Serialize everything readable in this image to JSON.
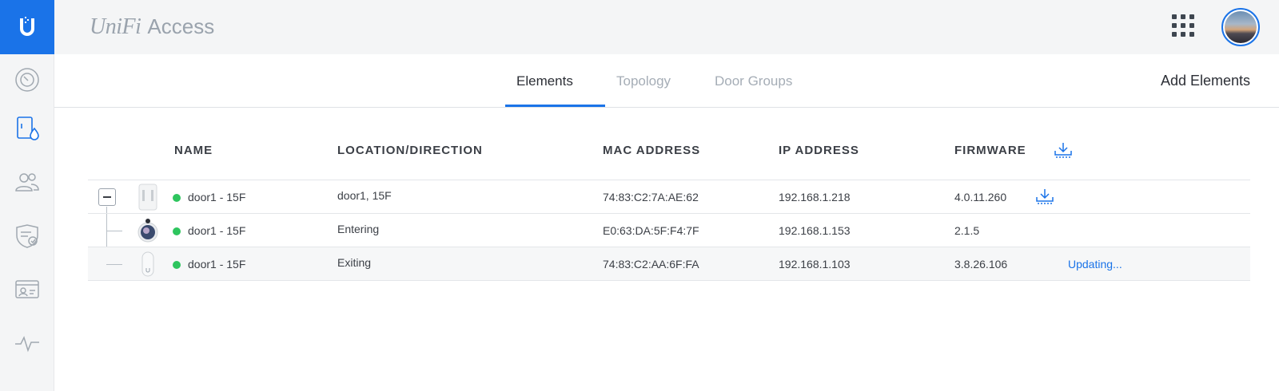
{
  "brand": {
    "logo_word": "UniFi",
    "app_name": "Access",
    "accent": "#1a73e8"
  },
  "sidebar": {
    "items": [
      {
        "name": "dashboard",
        "icon": "gauge-icon"
      },
      {
        "name": "doors",
        "icon": "door-icon",
        "active": true
      },
      {
        "name": "users",
        "icon": "users-icon"
      },
      {
        "name": "access-policies",
        "icon": "shield-list-icon"
      },
      {
        "name": "id-cards",
        "icon": "id-card-icon"
      },
      {
        "name": "activity",
        "icon": "pulse-icon"
      }
    ]
  },
  "header": {
    "apps_icon": "grid-apps-icon",
    "avatar_icon": "user-avatar"
  },
  "tabs": [
    {
      "label": "Elements",
      "active": true
    },
    {
      "label": "Topology",
      "active": false
    },
    {
      "label": "Door Groups",
      "active": false
    }
  ],
  "add_elements_label": "Add Elements",
  "table": {
    "columns": [
      "NAME",
      "LOCATION/DIRECTION",
      "MAC ADDRESS",
      "IP ADDRESS",
      "FIRMWARE"
    ],
    "rows": [
      {
        "name": "door1 - 15F",
        "location": "door1, 15F",
        "mac": "74:83:C2:7A:AE:62",
        "ip": "192.168.1.218",
        "firmware": "4.0.11.260",
        "status": "online",
        "device_icon": "hub-device-icon",
        "action": "download"
      },
      {
        "name": "door1 - 15F",
        "location": "Entering",
        "mac": "E0:63:DA:5F:F4:7F",
        "ip": "192.168.1.153",
        "firmware": "2.1.5",
        "status": "online",
        "device_icon": "camera-reader-icon",
        "action": ""
      },
      {
        "name": "door1 - 15F",
        "location": "Exiting",
        "mac": "74:83:C2:AA:6F:FA",
        "ip": "192.168.1.103",
        "firmware": "3.8.26.106",
        "status": "online",
        "device_icon": "reader-device-icon",
        "action": "Updating..."
      }
    ]
  },
  "colors": {
    "status_online": "#2ec55e",
    "link": "#1a73e8"
  }
}
